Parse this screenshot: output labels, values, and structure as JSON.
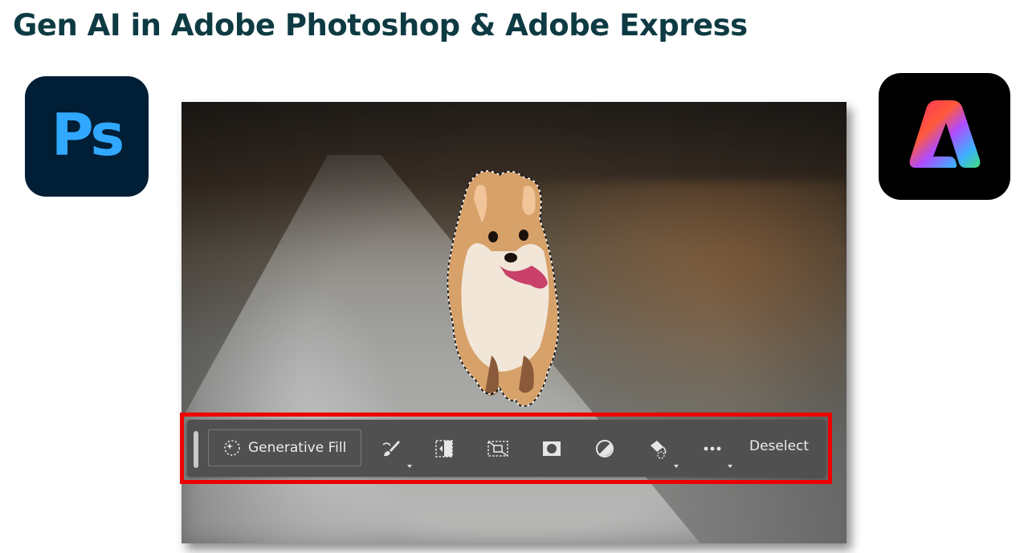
{
  "slide": {
    "title": "Gen AI in Adobe Photoshop & Adobe Express"
  },
  "logos": {
    "photoshop": {
      "text": "Ps",
      "bg": "#001e36",
      "fg": "#31a8ff"
    },
    "express": {
      "icon": "adobe-express-logo",
      "bg": "#000000"
    }
  },
  "contextual_taskbar": {
    "generative_fill_label": "Generative Fill",
    "deselect_label": "Deselect",
    "tools": [
      {
        "icon": "brush-icon",
        "has_menu": true
      },
      {
        "icon": "select-inverse-icon",
        "has_menu": false
      },
      {
        "icon": "transform-selection-icon",
        "has_menu": false
      },
      {
        "icon": "mask-icon",
        "has_menu": false
      },
      {
        "icon": "adjustment-icon",
        "has_menu": false
      },
      {
        "icon": "fill-icon",
        "has_menu": true
      },
      {
        "icon": "more-icon",
        "has_menu": true
      }
    ],
    "highlight_color": "#ee0000"
  }
}
